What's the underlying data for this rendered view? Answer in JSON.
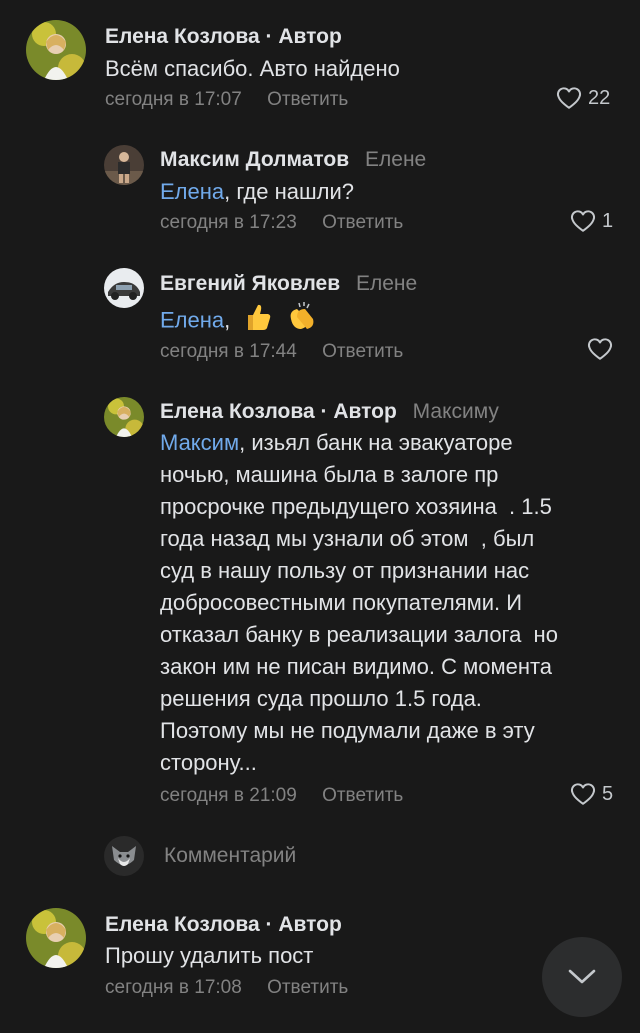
{
  "comments": [
    {
      "author": "Елена Козлова",
      "role": "· Автор",
      "text": "Всём спасибо. Авто найдено",
      "time": "сегодня в 17:07",
      "reply_label": "Ответить",
      "likes": "22"
    },
    {
      "author": "Максим Долматов",
      "reply_to": "Елене",
      "mention": "Елена",
      "text": ", где нашли?",
      "time": "сегодня в 17:23",
      "reply_label": "Ответить",
      "likes": "1"
    },
    {
      "author": "Евгений Яковлев",
      "reply_to": "Елене",
      "mention": "Елена",
      "text": ",",
      "emoji": [
        "thumbs-up-emoji",
        "clapping-hands-emoji"
      ],
      "time": "сегодня в 17:44",
      "reply_label": "Ответить",
      "likes": ""
    },
    {
      "author": "Елена Козлова",
      "role": "· Автор",
      "reply_to": "Максиму",
      "mention": "Максим",
      "text_lines": [
        ", изьял банк на эвакуаторе",
        "ночью, машина была в залоге пр",
        "просрочке предыдущего хозяина  . 1.5",
        "года назад мы узнали об этом  , был",
        "суд в нашу пользу от признании нас",
        "добросовестными покупателями. И",
        "отказал банку в реализации залога  но",
        "закон им не писан видимо. С момента",
        "решения суда прошло 1.5 года.",
        "Поэтому мы не подумали даже в эту",
        "сторону..."
      ],
      "time": "сегодня в 21:09",
      "reply_label": "Ответить",
      "likes": "5"
    },
    {
      "author": "Елена Козлова",
      "role": "· Автор",
      "text": "Прошу удалить пост",
      "time": "сегодня в 17:08",
      "reply_label": "Ответить"
    }
  ],
  "composer": {
    "placeholder": "Комментарий"
  },
  "colors": {
    "background": "#191919",
    "mention": "#71aaeb",
    "secondary": "#828282"
  }
}
